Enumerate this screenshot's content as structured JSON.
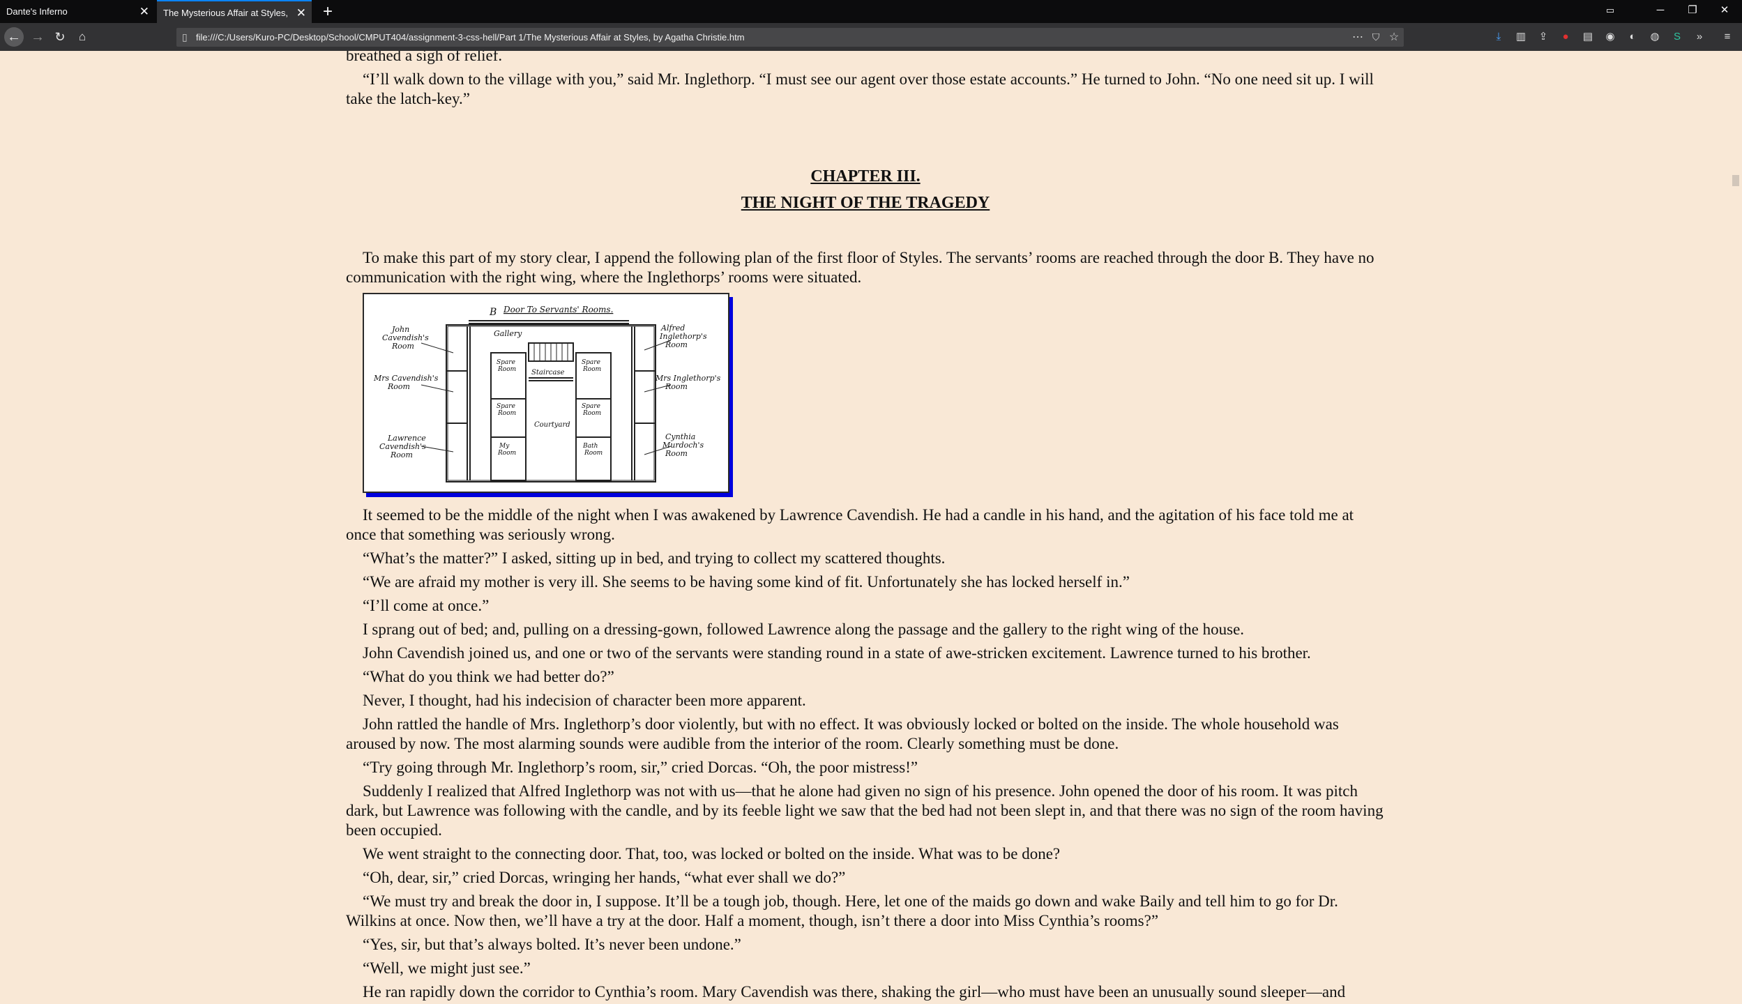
{
  "browser": {
    "tabs": [
      {
        "title": "Dante's Inferno",
        "close": "✕",
        "active": false
      },
      {
        "title": "The Mysterious Affair at Styles, by Agatha Christie",
        "close": "✕",
        "active": true
      }
    ],
    "new_tab": "+",
    "url": "file:///C:/Users/Kuro-PC/Desktop/School/CMPUT404/assignment-3-css-hell/Part 1/The Mysterious Affair at Styles, by Agatha Christie.htm",
    "window_controls": {
      "minimize": "─",
      "restore": "❐",
      "close": "✕"
    }
  },
  "page": {
    "top_fragment": "breathed a sigh of relief.",
    "para_before": "“I’ll walk down to the village with you,” said Mr. Inglethorp. “I must see our agent over those estate accounts.” He turned to John. “No one need sit up. I will take the latch-key.”",
    "chapter_number": "CHAPTER III.",
    "chapter_title": "THE NIGHT OF THE TRAGEDY",
    "intro": "To make this part of my story clear, I append the following plan of the first floor of Styles. The servants’ rooms are reached through the door B. They have no communication with the right wing, where the Inglethorps’ rooms were situated.",
    "plan_labels": {
      "door": "B",
      "door_caption": "Door To Servants' Rooms.",
      "gallery": "Gallery",
      "staircase": "Staircase",
      "courtyard": "Courtyard",
      "john": [
        "John",
        "Cavendish's",
        "Room"
      ],
      "mrs_cavendish": [
        "Mrs Cavendish's",
        "Room"
      ],
      "lawrence": [
        "Lawrence",
        "Cavendish's",
        "Room"
      ],
      "alfred": [
        "Alfred",
        "Inglethorp's",
        "Room"
      ],
      "mrs_inglethorp": [
        "Mrs Inglethorp's",
        "Room"
      ],
      "cynthia": [
        "Cynthia",
        "Murdoch's",
        "Room"
      ],
      "spare_room": [
        "Spare",
        "Room"
      ],
      "my_room": [
        "My",
        "Room"
      ],
      "bath_room": [
        "Bath",
        "Room"
      ]
    },
    "paragraphs": [
      "It seemed to be the middle of the night when I was awakened by Lawrence Cavendish. He had a candle in his hand, and the agitation of his face told me at once that something was seriously wrong.",
      "“What’s the matter?” I asked, sitting up in bed, and trying to collect my scattered thoughts.",
      "“We are afraid my mother is very ill. She seems to be having some kind of fit. Unfortunately she has locked herself in.”",
      "“I’ll come at once.”",
      "I sprang out of bed; and, pulling on a dressing-gown, followed Lawrence along the passage and the gallery to the right wing of the house.",
      "John Cavendish joined us, and one or two of the servants were standing round in a state of awe-stricken excitement. Lawrence turned to his brother.",
      "“What do you think we had better do?”",
      "Never, I thought, had his indecision of character been more apparent.",
      "John rattled the handle of Mrs. Inglethorp’s door violently, but with no effect. It was obviously locked or bolted on the inside. The whole household was aroused by now. The most alarming sounds were audible from the interior of the room. Clearly something must be done.",
      "“Try going through Mr. Inglethorp’s room, sir,” cried Dorcas. “Oh, the poor mistress!”",
      "Suddenly I realized that Alfred Inglethorp was not with us—that he alone had given no sign of his presence. John opened the door of his room. It was pitch dark, but Lawrence was following with the candle, and by its feeble light we saw that the bed had not been slept in, and that there was no sign of the room having been occupied.",
      "We went straight to the connecting door. That, too, was locked or bolted on the inside. What was to be done?",
      "“Oh, dear, sir,” cried Dorcas, wringing her hands, “what ever shall we do?”",
      "“We must try and break the door in, I suppose. It’ll be a tough job, though. Here, let one of the maids go down and wake Baily and tell him to go for Dr. Wilkins at once. Now then, we’ll have a try at the door. Half a moment, though, isn’t there a door into Miss Cynthia’s rooms?”",
      "“Yes, sir, but that’s always bolted. It’s never been undone.”",
      "“Well, we might just see.”",
      "He ran rapidly down the corridor to Cynthia’s room. Mary Cavendish was there, shaking the girl—who must have been an unusually sound sleeper—and"
    ]
  },
  "colors": {
    "page_background": "#f9e8d6",
    "figure_shadow": "#0000dd",
    "tabbar": "#0c0c0d",
    "toolbar": "#323234"
  }
}
